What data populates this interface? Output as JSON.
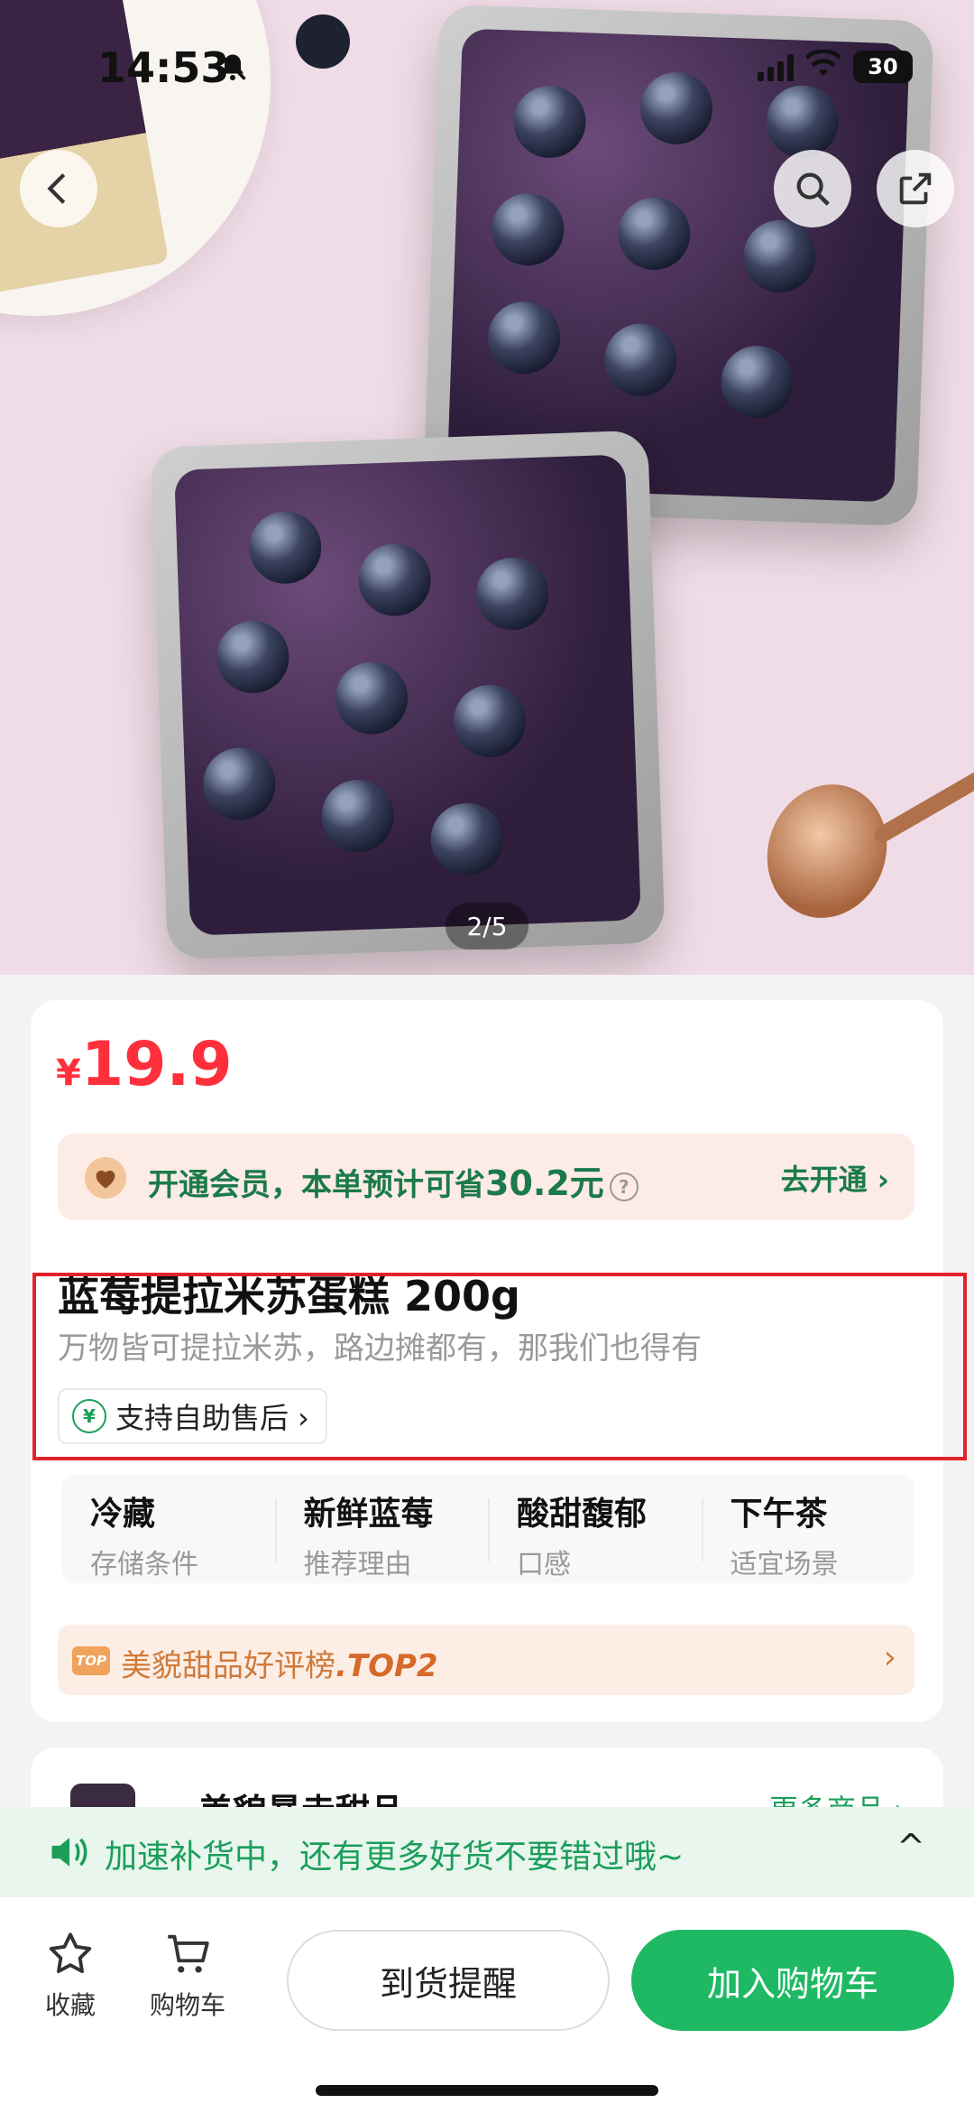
{
  "status_bar": {
    "time": "14:53",
    "battery": "30"
  },
  "hero": {
    "pager": "2/5"
  },
  "product": {
    "currency": "¥",
    "price": "19.9",
    "member": {
      "text": "开通会员，本单预计可省",
      "amount": "30.2元",
      "help": "?",
      "link": "去开通 ›"
    },
    "title": "蓝莓提拉米苏蛋糕 200g",
    "subtitle": "万物皆可提拉米苏，路边摊都有，那我们也得有",
    "after_sale": "支持自助售后 ›",
    "after_sale_icon": "¥",
    "attributes": [
      {
        "value": "冷藏",
        "key": "存储条件"
      },
      {
        "value": "新鲜蓝莓",
        "key": "推荐理由"
      },
      {
        "value": "酸甜馥郁",
        "key": "口感"
      },
      {
        "value": "下午茶",
        "key": "适宜场景"
      }
    ],
    "rank": {
      "badge": "TOP",
      "text": "美貌甜品好评榜",
      "top": ".TOP2",
      "chevron": "›"
    }
  },
  "shop": {
    "name": "美貌暴走甜品",
    "more": "更多商品 ›"
  },
  "notice": {
    "text": "加速补货中，还有更多好货不要错过哦~",
    "caret": "^"
  },
  "bottom": {
    "favorite": "收藏",
    "cart": "购物车",
    "notify_button": "到货提醒",
    "add_cart_button": "加入购物车"
  },
  "colors": {
    "accent_green": "#1fb964",
    "price_red": "#ff2f3c",
    "highlight_box": "#e4222c"
  }
}
